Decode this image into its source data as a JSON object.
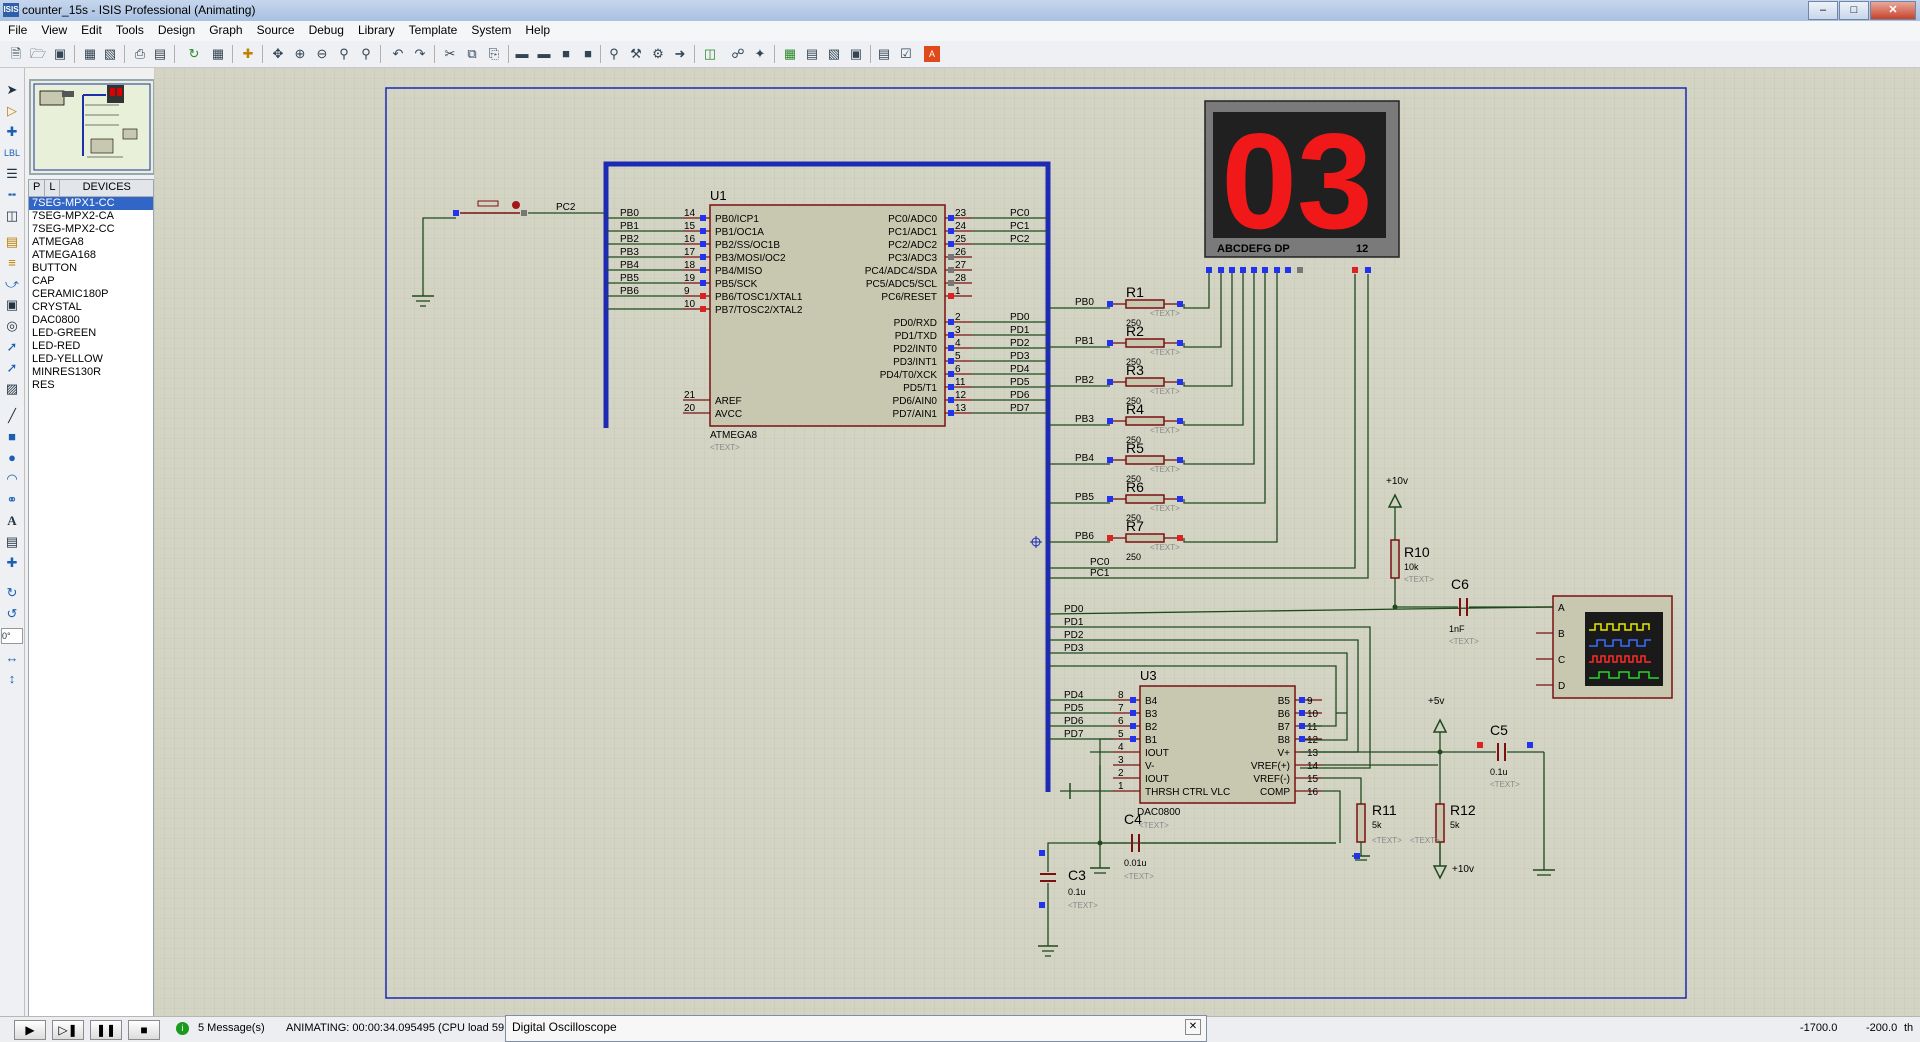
{
  "window": {
    "title": "counter_15s - ISIS Professional (Animating)",
    "app_icon": "ISIS"
  },
  "menu": [
    "File",
    "View",
    "Edit",
    "Tools",
    "Design",
    "Graph",
    "Source",
    "Debug",
    "Library",
    "Template",
    "System",
    "Help"
  ],
  "devices": {
    "tab_p": "P",
    "tab_l": "L",
    "label": "DEVICES",
    "items": [
      "7SEG-MPX1-CC",
      "7SEG-MPX2-CA",
      "7SEG-MPX2-CC",
      "ATMEGA8",
      "ATMEGA168",
      "BUTTON",
      "CAP",
      "CERAMIC180P",
      "CRYSTAL",
      "DAC0800",
      "LED-GREEN",
      "LED-RED",
      "LED-YELLOW",
      "MINRES130R",
      "RES"
    ],
    "selected_index": 0
  },
  "rotation_value": "0°",
  "status": {
    "messages": "5 Message(s)",
    "animating": "ANIMATING: 00:00:34.095495 (CPU load 59",
    "coord_x": "-1700.0",
    "coord_y": "-200.0",
    "units": "th"
  },
  "oscilloscope_window": {
    "title": "Digital Oscilloscope"
  },
  "schematic": {
    "display": {
      "digits": "03",
      "pin_label": "ABCDEFG  DP",
      "pin_nums": "12"
    },
    "u1": {
      "ref": "U1",
      "part": "ATMEGA8",
      "text": "<TEXT>",
      "left_pins": [
        [
          "14",
          "PB0/ICP1"
        ],
        [
          "15",
          "PB1/OC1A"
        ],
        [
          "16",
          "PB2/SS/OC1B"
        ],
        [
          "17",
          "PB3/MOSI/OC2"
        ],
        [
          "18",
          "PB4/MISO"
        ],
        [
          "19",
          "PB5/SCK"
        ],
        [
          "9",
          "PB6/TOSC1/XTAL1"
        ],
        [
          "10",
          "PB7/TOSC2/XTAL2"
        ]
      ],
      "left_nets": [
        "PB0",
        "PB1",
        "PB2",
        "PB3",
        "PB4",
        "PB5",
        "PB6",
        ""
      ],
      "left_bottom": [
        [
          "21",
          "AREF"
        ],
        [
          "20",
          "AVCC"
        ]
      ],
      "right_pins": [
        [
          "23",
          "PC0/ADC0"
        ],
        [
          "24",
          "PC1/ADC1"
        ],
        [
          "25",
          "PC2/ADC2"
        ],
        [
          "26",
          "PC3/ADC3"
        ],
        [
          "27",
          "PC4/ADC4/SDA"
        ],
        [
          "28",
          "PC5/ADC5/SCL"
        ],
        [
          "1",
          "PC6/RESET"
        ]
      ],
      "right_nets": [
        "PC0",
        "PC1",
        "PC2",
        "",
        "",
        "",
        ""
      ],
      "right_pins2": [
        [
          "2",
          "PD0/RXD"
        ],
        [
          "3",
          "PD1/TXD"
        ],
        [
          "4",
          "PD2/INT0"
        ],
        [
          "5",
          "PD3/INT1"
        ],
        [
          "6",
          "PD4/T0/XCK"
        ],
        [
          "11",
          "PD5/T1"
        ],
        [
          "12",
          "PD6/AIN0"
        ],
        [
          "13",
          "PD7/AIN1"
        ]
      ],
      "right_nets2": [
        "PD0",
        "PD1",
        "PD2",
        "PD3",
        "PD4",
        "PD5",
        "PD6",
        "PD7"
      ]
    },
    "button_net": "PC2",
    "resistors": [
      {
        "ref": "R1",
        "val": "250",
        "net": "PB0"
      },
      {
        "ref": "R2",
        "val": "250",
        "net": "PB1"
      },
      {
        "ref": "R3",
        "val": "250",
        "net": "PB2"
      },
      {
        "ref": "R4",
        "val": "250",
        "net": "PB3"
      },
      {
        "ref": "R5",
        "val": "250",
        "net": "PB4"
      },
      {
        "ref": "R6",
        "val": "250",
        "net": "PB5"
      },
      {
        "ref": "R7",
        "val": "250",
        "net": "PB6"
      }
    ],
    "text_tag": "<TEXT>",
    "pc_nets": [
      "PC0",
      "PC1"
    ],
    "pd_nets": [
      "PD0",
      "PD1",
      "PD2",
      "PD3"
    ],
    "r10": {
      "ref": "R10",
      "val": "10k",
      "power": "+10v"
    },
    "c6": {
      "ref": "C6",
      "val": "1nF"
    },
    "scope_channels": [
      "A",
      "B",
      "C",
      "D"
    ],
    "u3": {
      "ref": "U3",
      "part": "DAC0800",
      "left": [
        [
          "8",
          "B4"
        ],
        [
          "7",
          "B3"
        ],
        [
          "6",
          "B2"
        ],
        [
          "5",
          "B1"
        ],
        [
          "4",
          "IOUT"
        ],
        [
          "3",
          "V-"
        ],
        [
          "2",
          "IOUT"
        ],
        [
          "1",
          "THRSH CTRL VLC"
        ]
      ],
      "left_nets": [
        "PD4",
        "PD5",
        "PD6",
        "PD7"
      ],
      "right": [
        [
          "9",
          "B5"
        ],
        [
          "10",
          "B6"
        ],
        [
          "11",
          "B7"
        ],
        [
          "12",
          "B8"
        ],
        [
          "13",
          "V+"
        ],
        [
          "14",
          "VREF(+)"
        ],
        [
          "15",
          "VREF(-)"
        ],
        [
          "16",
          "COMP"
        ]
      ]
    },
    "c5": {
      "ref": "C5",
      "val": "0.1u",
      "power": "+5v"
    },
    "r11": {
      "ref": "R11",
      "val": "5k"
    },
    "r12": {
      "ref": "R12",
      "val": "5k",
      "power": "+10v"
    },
    "c4": {
      "ref": "C4",
      "val": "0.01u"
    },
    "c3": {
      "ref": "C3",
      "val": "0.1u"
    }
  }
}
